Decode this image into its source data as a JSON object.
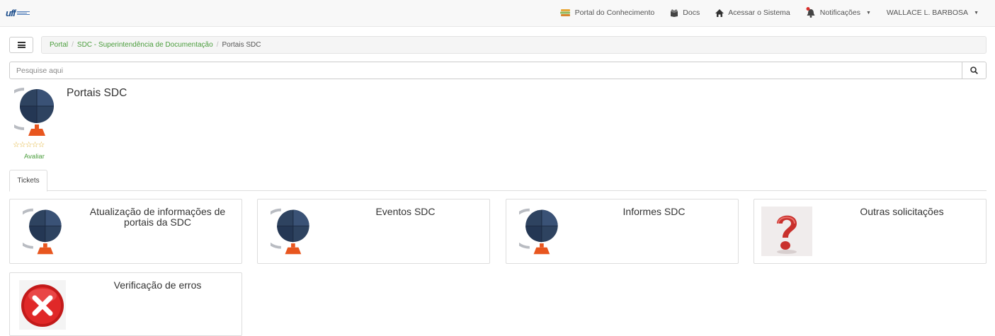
{
  "navbar": {
    "logo_text": "uff",
    "items": [
      {
        "label": "Portal do Conhecimento",
        "icon": "books-icon"
      },
      {
        "label": "Docs",
        "icon": "box-icon"
      },
      {
        "label": "Acessar o Sistema",
        "icon": "home-icon"
      },
      {
        "label": "Notificações",
        "icon": "bell-icon"
      },
      {
        "label": "WALLACE L. BARBOSA",
        "icon": "user-menu"
      }
    ]
  },
  "breadcrumb": {
    "items": [
      "Portal",
      "SDC - Superintendência de Documentação"
    ],
    "current": "Portais SDC"
  },
  "search": {
    "placeholder": "Pesquise aqui"
  },
  "portal": {
    "title": "Portais SDC",
    "rating_stars": "☆☆☆☆☆",
    "rate_label": "Avaliar"
  },
  "tabs": [
    {
      "label": "Tickets"
    }
  ],
  "cards": [
    {
      "title": "Atualização de informações de portais da SDC",
      "icon": "globe-icon"
    },
    {
      "title": "Eventos SDC",
      "icon": "globe-icon"
    },
    {
      "title": "Informes SDC",
      "icon": "globe-icon"
    },
    {
      "title": "Outras solicitações",
      "icon": "question-mark-icon"
    },
    {
      "title": "Verificação de erros",
      "icon": "error-x-icon"
    }
  ],
  "colors": {
    "link_green": "#4a9d3c",
    "globe_blue": "#2e4360",
    "stand_orange": "#e8561f",
    "star_gold": "#e0b030"
  }
}
